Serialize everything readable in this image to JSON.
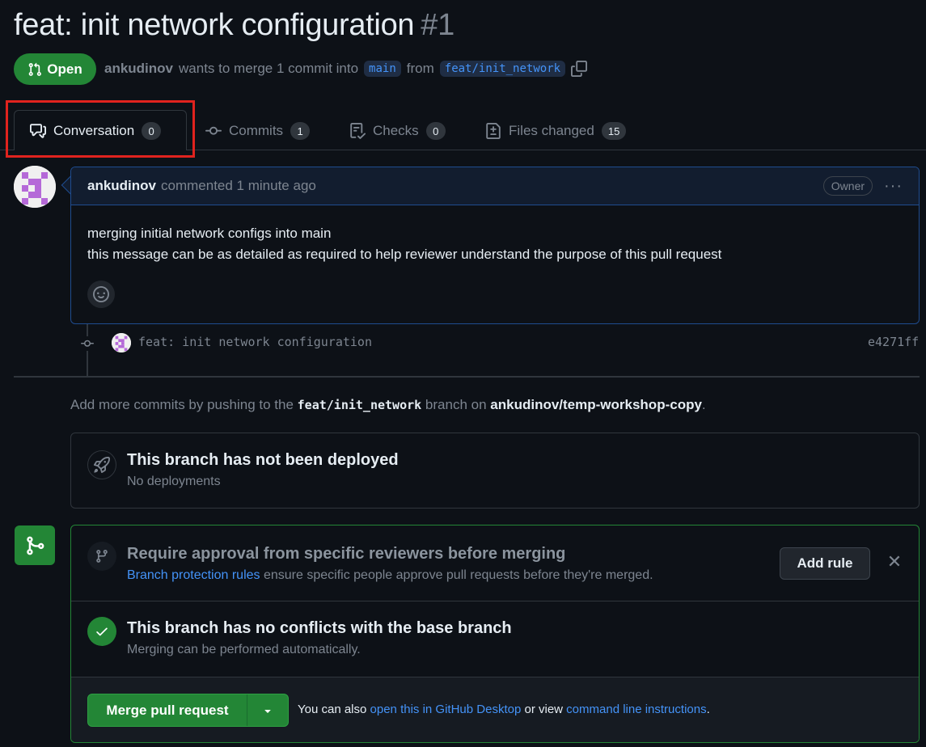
{
  "pr": {
    "title": "feat: init network configuration",
    "number": "#1",
    "state": "Open",
    "author": "ankudinov",
    "merge_text": "wants to merge 1 commit into",
    "base_branch": "main",
    "from_text": "from",
    "head_branch": "feat/init_network"
  },
  "tabs": [
    {
      "label": "Conversation",
      "count": "0"
    },
    {
      "label": "Commits",
      "count": "1"
    },
    {
      "label": "Checks",
      "count": "0"
    },
    {
      "label": "Files changed",
      "count": "15"
    }
  ],
  "comment": {
    "author": "ankudinov",
    "meta": "commented 1 minute ago",
    "badge": "Owner",
    "body_line1": "merging initial network configs into main",
    "body_line2": "this message can be as detailed as required to help reviewer understand the purpose of this pull request"
  },
  "commit": {
    "message": "feat: init network configuration",
    "sha": "e4271ff"
  },
  "push_hint": {
    "prefix": "Add more commits by pushing to the",
    "branch": "feat/init_network",
    "middle": "branch on",
    "repo": "ankudinov/temp-workshop-copy",
    "suffix": "."
  },
  "deploy": {
    "title": "This branch has not been deployed",
    "subtitle": "No deployments"
  },
  "protection": {
    "title": "Require approval from specific reviewers before merging",
    "link": "Branch protection rules",
    "text": "ensure specific people approve pull requests before they're merged.",
    "button": "Add rule",
    "close": "✕"
  },
  "conflicts": {
    "title": "This branch has no conflicts with the base branch",
    "subtitle": "Merging can be performed automatically."
  },
  "merge": {
    "button": "Merge pull request",
    "also_prefix": "You can also",
    "desktop_link": "open this in GitHub Desktop",
    "or_view": "or view",
    "cli_link": "command line instructions",
    "period": "."
  },
  "colors": {
    "background": "#0d1117",
    "accent_green": "#238636",
    "link_blue": "#4493f8",
    "highlight_red": "#e0231e"
  },
  "icons": [
    "git-pull-request-icon",
    "copy-icon",
    "comment-discussion-icon",
    "git-commit-icon",
    "checklist-icon",
    "file-diff-icon",
    "kebab-horizontal-icon",
    "smiley-icon",
    "rocket-icon",
    "git-merge-icon",
    "git-branch-icon",
    "check-icon",
    "triangle-down-icon",
    "close-icon"
  ]
}
